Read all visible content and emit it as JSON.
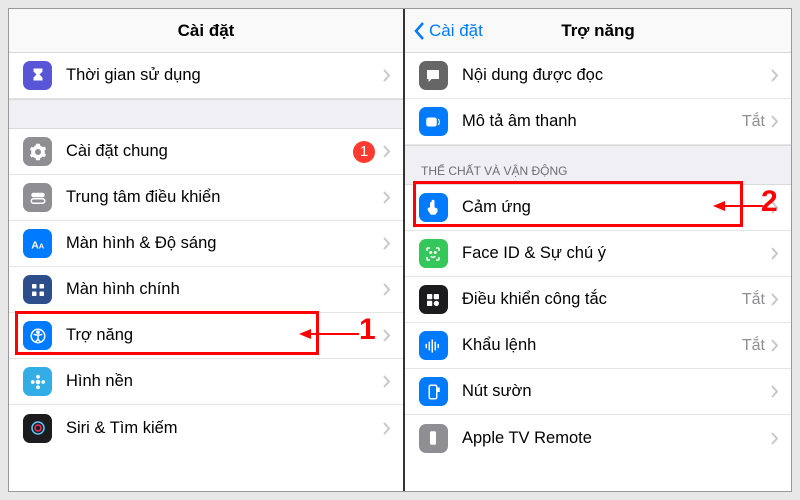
{
  "left": {
    "title": "Cài đặt",
    "rows": {
      "screentime": "Thời gian sử dụng",
      "general": "Cài đặt chung",
      "general_badge": "1",
      "control": "Trung tâm điều khiển",
      "display": "Màn hình & Độ sáng",
      "home": "Màn hình chính",
      "accessibility": "Trợ năng",
      "wallpaper": "Hình nền",
      "siri": "Siri & Tìm kiếm"
    },
    "step": "1"
  },
  "right": {
    "back": "Cài đặt",
    "title": "Trợ năng",
    "rows": {
      "spoken": "Nội dung được đọc",
      "audiodesc": "Mô tả âm thanh",
      "audiodesc_val": "Tắt",
      "section_physical": "THỂ CHẤT VÀ VẬN ĐỘNG",
      "touch": "Cảm ứng",
      "faceid": "Face ID & Sự chú ý",
      "switch": "Điều khiển công tắc",
      "switch_val": "Tắt",
      "voice": "Khẩu lệnh",
      "voice_val": "Tắt",
      "side": "Nút sườn",
      "appletv": "Apple TV Remote"
    },
    "step": "2"
  }
}
